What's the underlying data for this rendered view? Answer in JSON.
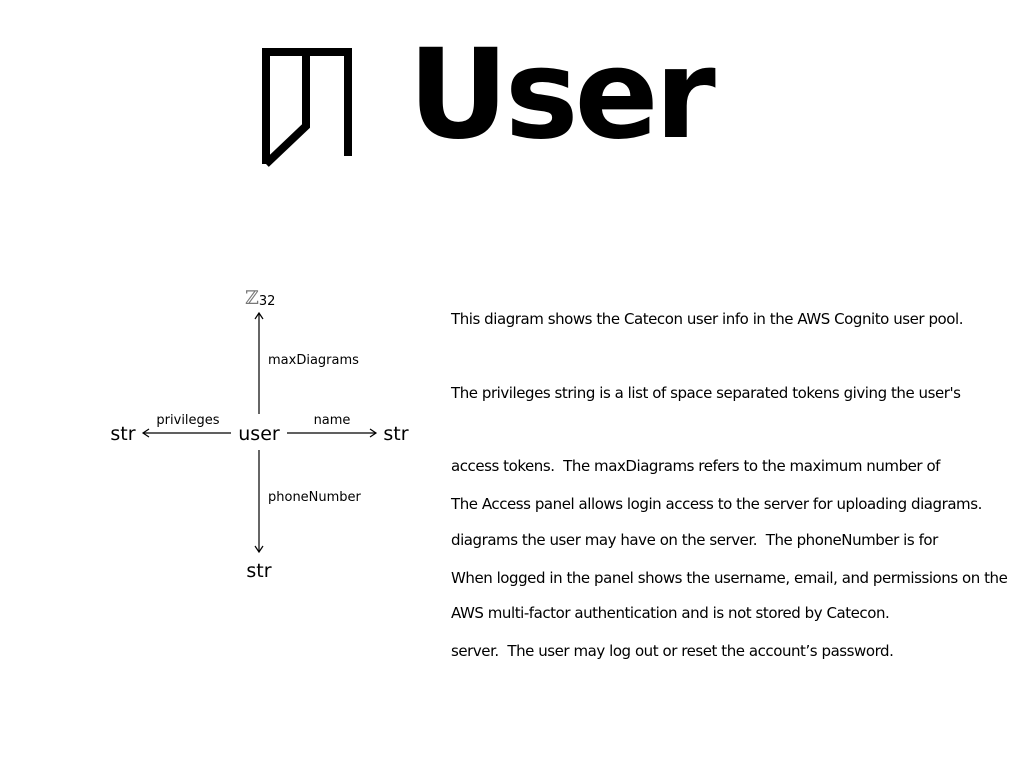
{
  "header": {
    "title": "User",
    "logo_icon": "catecon-logo-icon"
  },
  "diagram": {
    "nodes": {
      "center": "user",
      "top": "ℤ",
      "top_subscript": "32",
      "left": "str",
      "right": "str",
      "bottom": "str"
    },
    "edges": {
      "top": "maxDiagrams",
      "left": "privileges",
      "right": "name",
      "bottom": "phoneNumber"
    }
  },
  "description": {
    "paragraph_1": [
      "This diagram shows the Catecon user info in the AWS Cognito user pool.",
      "The privileges string is a list of space separated tokens giving the user's",
      "access tokens.  The maxDiagrams refers to the maximum number of",
      "diagrams the user may have on the server.  The phoneNumber is for",
      "AWS multi-factor authentication and is not stored by Catecon."
    ],
    "paragraph_2": [
      "The Access panel allows login access to the server for uploading diagrams.",
      "When logged in the panel shows the username, email, and permissions on the",
      "server.  The user may log out or reset the account’s password."
    ]
  }
}
